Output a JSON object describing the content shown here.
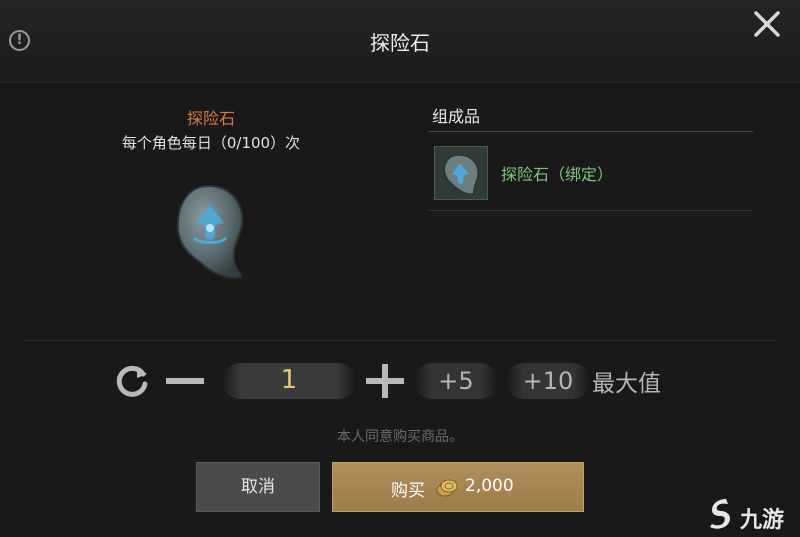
{
  "window": {
    "title": "探险石"
  },
  "item": {
    "name": "探险石",
    "daily_limit": "每个角色每日（0/100）次"
  },
  "components": {
    "header": "组成品",
    "items": [
      {
        "name": "探险石（绑定）"
      }
    ]
  },
  "quantity": {
    "value": "1",
    "step5_label": "+5",
    "step10_label": "+10",
    "max_label": "最大值"
  },
  "agree_text": "本人同意购买商品。",
  "buttons": {
    "cancel_label": "取消",
    "buy_label": "购买",
    "price": "2,000"
  },
  "watermark": {
    "text": "九游"
  },
  "icons": {
    "info": "info-icon",
    "close": "close-icon",
    "reset": "reset-icon",
    "minus": "minus-icon",
    "plus": "plus-icon",
    "coin": "gold-coin-icon"
  },
  "colors": {
    "item_name": "#d67a45",
    "component_name": "#7fc47b",
    "quantity_value": "#e4c97b",
    "buy_button": "#a8875a"
  }
}
